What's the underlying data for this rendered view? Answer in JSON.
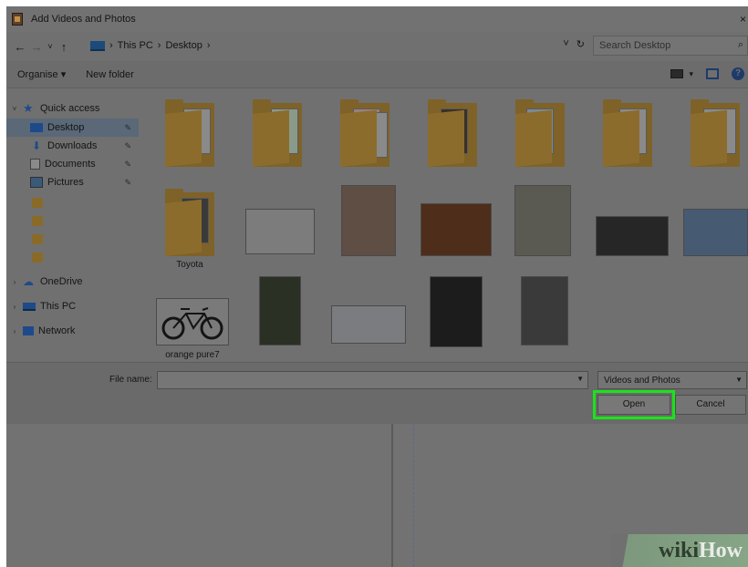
{
  "window": {
    "title": "Add Videos and Photos",
    "close_glyph": "×"
  },
  "nav": {
    "back": "←",
    "forward": "→",
    "recent": "˅",
    "up": "↑",
    "breadcrumb": [
      "This PC",
      "Desktop"
    ],
    "separator": "›",
    "dropdown": "˅",
    "refresh": "↻"
  },
  "search": {
    "placeholder": "Search Desktop",
    "icon": "search-icon"
  },
  "toolbar": {
    "organise": "Organise ▾",
    "new_folder": "New folder",
    "view_dropdown": "▾",
    "help": "?"
  },
  "sidebar": {
    "quick_access": "Quick access",
    "items": [
      {
        "label": "Desktop",
        "icon": "desktop-icon",
        "pinned": true,
        "selected": true
      },
      {
        "label": "Downloads",
        "icon": "download-icon",
        "pinned": true
      },
      {
        "label": "Documents",
        "icon": "documents-icon",
        "pinned": true
      },
      {
        "label": "Pictures",
        "icon": "pictures-icon",
        "pinned": true
      }
    ],
    "folders_count": 4,
    "onedrive": "OneDrive",
    "this_pc": "This PC",
    "network": "Network"
  },
  "files": [
    {
      "type": "folder",
      "label": ""
    },
    {
      "type": "folder",
      "label": ""
    },
    {
      "type": "folder",
      "label": ""
    },
    {
      "type": "folder",
      "label": ""
    },
    {
      "type": "folder",
      "label": ""
    },
    {
      "type": "folder",
      "label": ""
    },
    {
      "type": "folder",
      "label": ""
    },
    {
      "type": "folder",
      "label": "Toyota"
    },
    {
      "type": "image",
      "label": ""
    },
    {
      "type": "image",
      "label": ""
    },
    {
      "type": "image",
      "label": ""
    },
    {
      "type": "image",
      "label": ""
    },
    {
      "type": "image",
      "label": ""
    },
    {
      "type": "image",
      "label": ""
    },
    {
      "type": "image",
      "label": "orange pure7"
    },
    {
      "type": "image",
      "label": ""
    },
    {
      "type": "image",
      "label": ""
    },
    {
      "type": "image",
      "label": ""
    },
    {
      "type": "image",
      "label": ""
    }
  ],
  "filebar": {
    "file_name_label": "File name:",
    "file_name_value": "",
    "file_type": "Videos and Photos",
    "open": "Open",
    "cancel": "Cancel"
  },
  "watermark": {
    "part1": "wiki",
    "part2": "How"
  },
  "colors": {
    "highlight": "#19e419",
    "accent": "#1e4a8a"
  }
}
